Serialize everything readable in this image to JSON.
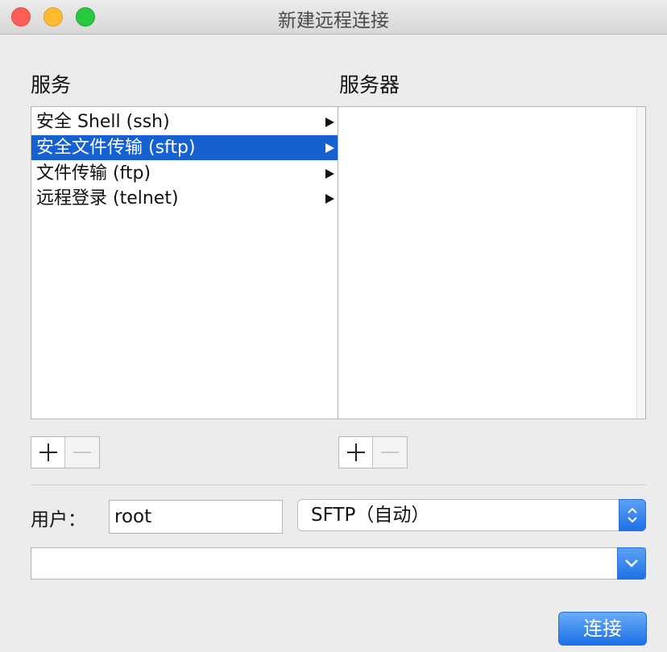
{
  "window": {
    "title": "新建远程连接"
  },
  "labels": {
    "services": "服务",
    "servers": "服务器",
    "user": "用户："
  },
  "services": [
    {
      "label": "安全 Shell (ssh)",
      "selected": false
    },
    {
      "label": "安全文件传输 (sftp)",
      "selected": true
    },
    {
      "label": "文件传输 (ftp)",
      "selected": false
    },
    {
      "label": "远程登录 (telnet)",
      "selected": false
    }
  ],
  "servers": [],
  "user_field": {
    "value": "root"
  },
  "protocol_select": {
    "value": "SFTP（自动）"
  },
  "server_field": {
    "value": ""
  },
  "buttons": {
    "connect": "连接"
  },
  "colors": {
    "selection": "#1561d1",
    "accent": "#1f70e6"
  }
}
